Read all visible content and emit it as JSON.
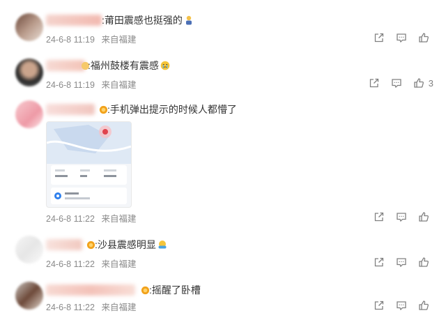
{
  "comments": [
    {
      "text": ":莆田震感也挺强的",
      "date": "24-6-8 11:19",
      "location": "来自福建",
      "likes": ""
    },
    {
      "text": ":福州鼓楼有震感",
      "date": "24-6-8 11:19",
      "location": "来自福建",
      "likes": "3"
    },
    {
      "text": ":手机弹出提示的时候人都懵了",
      "date": "24-6-8 11:22",
      "location": "来自福建",
      "likes": ""
    },
    {
      "text": ":沙县震感明显",
      "date": "24-6-8 11:22",
      "location": "来自福建",
      "likes": ""
    },
    {
      "text": ":摇醒了卧槽",
      "date": "24-6-8 11:22",
      "location": "来自福建",
      "likes": ""
    }
  ],
  "icons": {
    "share": "share-icon",
    "comment": "comment-icon",
    "like": "thumbs-up-icon"
  },
  "colors": {
    "meta_text": "#8a8a8a",
    "icon": "#808080",
    "badge": "#f2a21b"
  }
}
